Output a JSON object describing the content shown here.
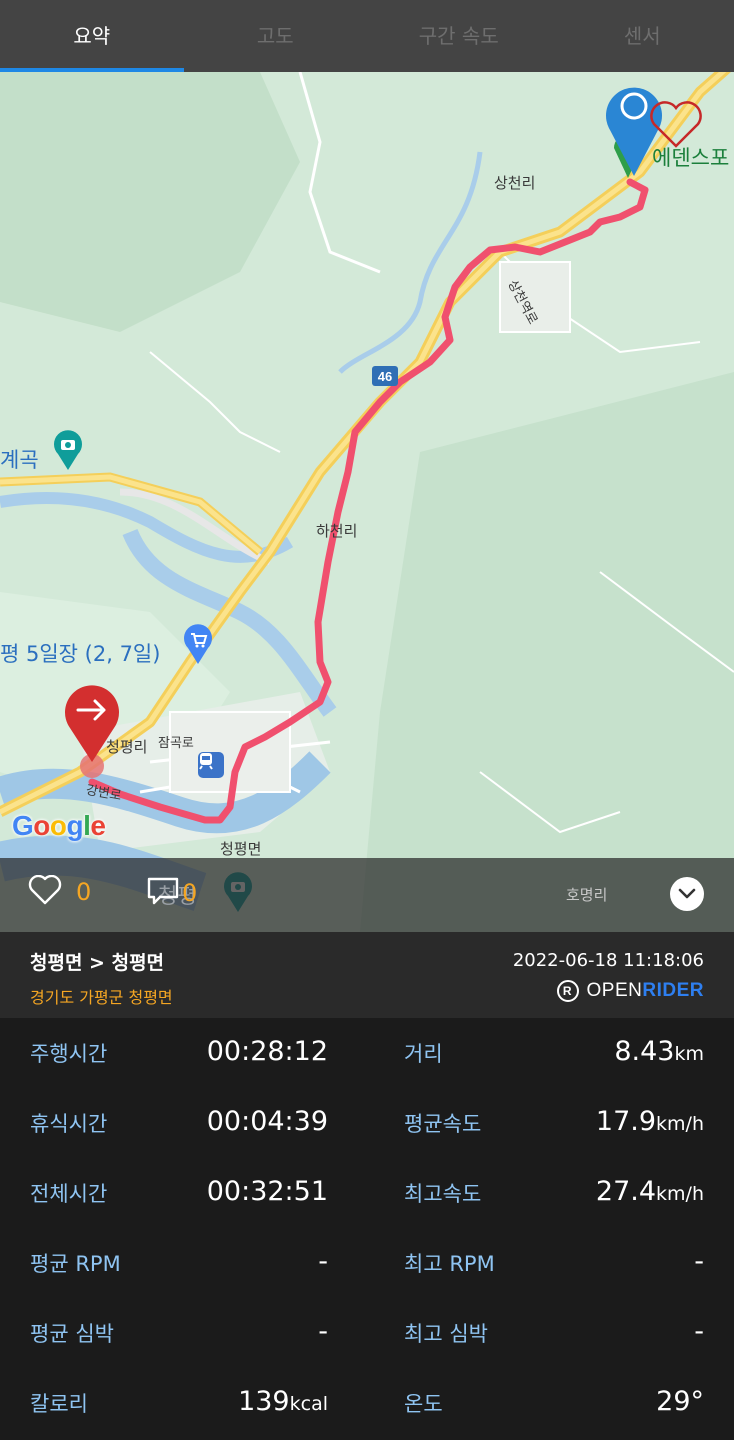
{
  "tabs": [
    {
      "label": "요약",
      "active": true
    },
    {
      "label": "고도",
      "active": false
    },
    {
      "label": "구간 속도",
      "active": false
    },
    {
      "label": "센서",
      "active": false
    }
  ],
  "map": {
    "labels": {
      "sangcheon_ri": "상천리",
      "sangcheon_road": "상천역로",
      "route_number": "46",
      "gyegok": "계곡",
      "hacheon_ri": "하천리",
      "market": "평 5일장 (2, 7일)",
      "cheongpyeong_ri": "청평리",
      "jamgok_ro": "잠곡로",
      "gangbyeon_ro": "강변로",
      "cheongpyeong_myeon": "청평면",
      "homyeong_ri": "호명리",
      "edenspo": "에덴스포",
      "cheongpyeong_poi": "청평",
      "google": "Google"
    },
    "route_color": "#f0506e",
    "start_marker_color": "#d32f2f",
    "end_marker_color": "#2a86d4"
  },
  "social": {
    "likes": "0",
    "comments": "0",
    "icons": [
      "heart-icon",
      "comment-icon",
      "chevron-down-icon"
    ]
  },
  "route": {
    "title": "청평면 > 청평면",
    "region": "경기도 가평군 청평면",
    "datetime": "2022-06-18 11:18:06",
    "brand_open": "OPEN",
    "brand_rider": "RIDER"
  },
  "stats": [
    {
      "left_label": "주행시간",
      "left_value": "00:28:12",
      "left_unit": "",
      "right_label": "거리",
      "right_value": "8.43",
      "right_unit": "km"
    },
    {
      "left_label": "휴식시간",
      "left_value": "00:04:39",
      "left_unit": "",
      "right_label": "평균속도",
      "right_value": "17.9",
      "right_unit": "km/h"
    },
    {
      "left_label": "전체시간",
      "left_value": "00:32:51",
      "left_unit": "",
      "right_label": "최고속도",
      "right_value": "27.4",
      "right_unit": "km/h"
    },
    {
      "left_label": "평균 RPM",
      "left_value": "-",
      "left_unit": "",
      "right_label": "최고 RPM",
      "right_value": "-",
      "right_unit": ""
    },
    {
      "left_label": "평균 심박",
      "left_value": "-",
      "left_unit": "",
      "right_label": "최고 심박",
      "right_value": "-",
      "right_unit": ""
    },
    {
      "left_label": "칼로리",
      "left_value": "139",
      "left_unit": "kcal",
      "right_label": "온도",
      "right_value": "29°",
      "right_unit": ""
    }
  ]
}
